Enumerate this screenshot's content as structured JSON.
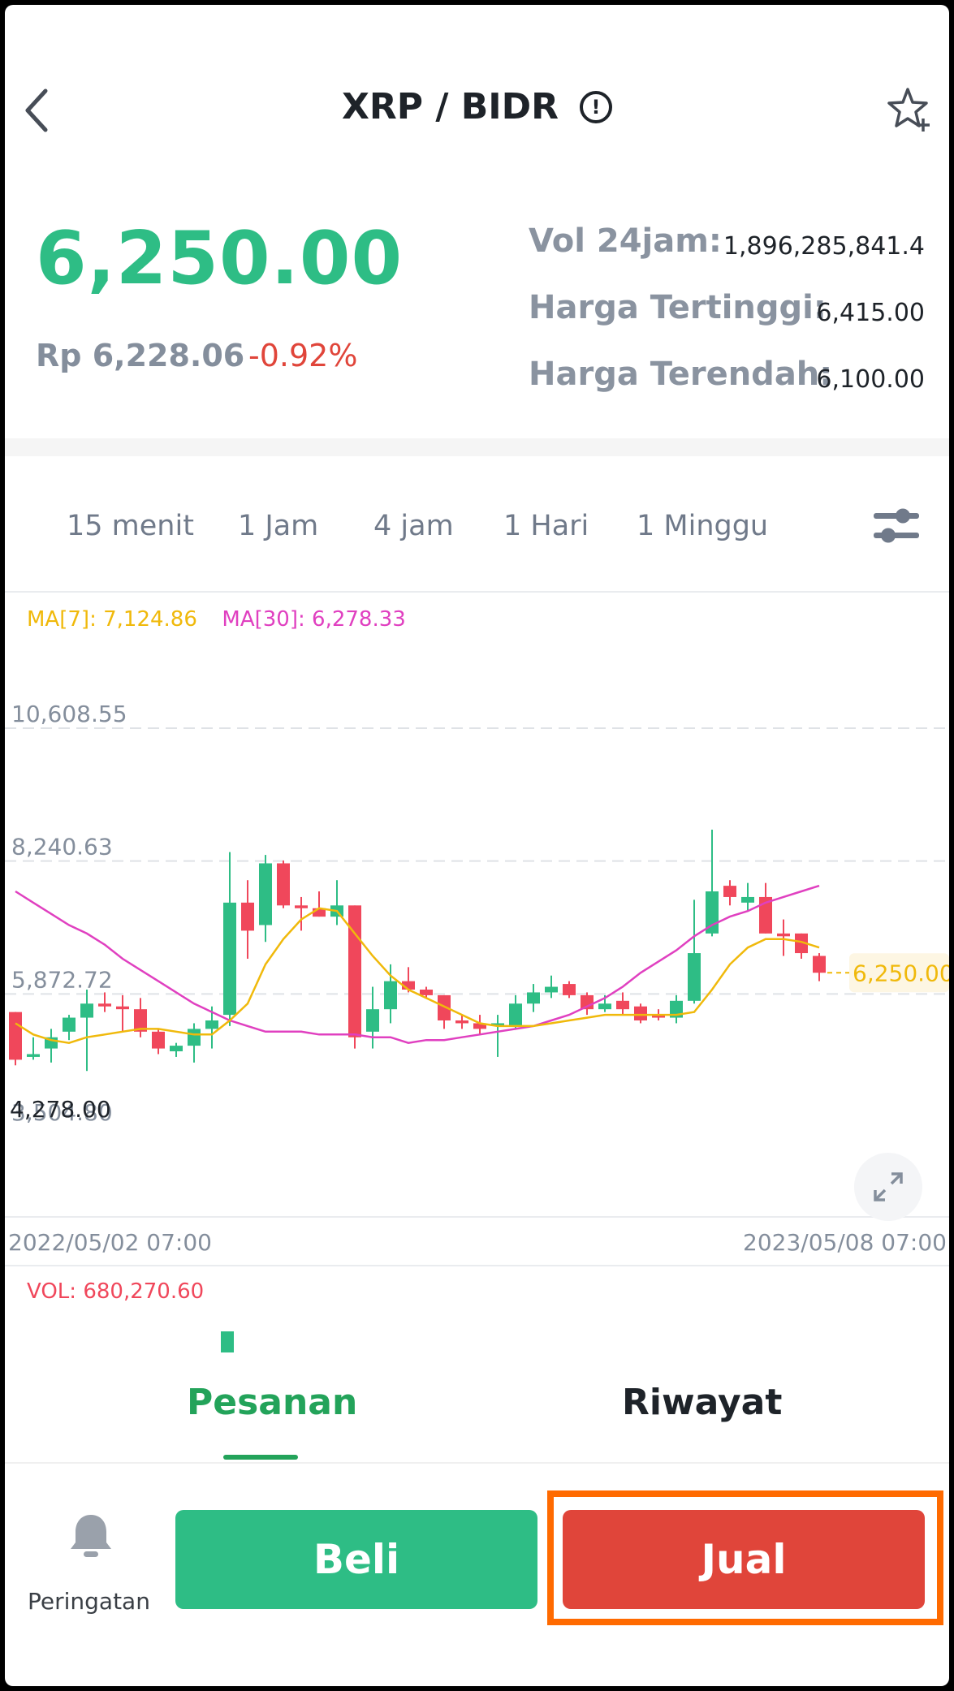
{
  "header": {
    "pair_title": "XRP / BIDR",
    "info_icon": "exclamation-circle-icon",
    "back_icon": "chevron-left-icon",
    "favorite_icon": "star-plus-icon"
  },
  "ticker": {
    "last_price": "6,250.00",
    "fiat_price": "Rp 6,228.06",
    "change_percent": "-0.92%",
    "stats": [
      {
        "label": "Vol 24jam:",
        "value": "1,896,285,841.4"
      },
      {
        "label": "Harga Tertinggi:",
        "value": "6,415.00"
      },
      {
        "label": "Harga Terendah:",
        "value": "6,100.00"
      }
    ]
  },
  "timeframes": [
    "15 menit",
    "1 Jam",
    "4 jam",
    "1 Hari",
    "1 Minggu"
  ],
  "chart_settings_icon": "sliders-icon",
  "expand_icon": "expand-diagonal-icon",
  "colors": {
    "up": "#2ebd85",
    "down": "#f0475b",
    "ma7": "#f0b90b",
    "ma30": "#e040c0",
    "sell": "#e0453a",
    "highlight": "#ff6a00"
  },
  "chart_data": {
    "type": "candlestick",
    "indicators": [
      {
        "name": "MA[7]",
        "value": "7,124.86"
      },
      {
        "name": "MA[30]",
        "value": "6,278.33"
      }
    ],
    "y_tick_labels": [
      "10,608.55",
      "8,240.63",
      "5,872.72",
      "3,504.80"
    ],
    "y_ticks": [
      10608.55,
      8240.63,
      5872.72,
      3504.8
    ],
    "ylim": [
      3504.8,
      10608.55
    ],
    "min_label": "4,278.00",
    "last_price_label": "6,250.00",
    "last_price": 6250.0,
    "x_start_label": "2022/05/02 07:00",
    "x_end_label": "2023/05/08 07:00",
    "candles": [
      {
        "o": 5550,
        "h": 5550,
        "l": 4600,
        "c": 4700
      },
      {
        "o": 4750,
        "h": 5100,
        "l": 4700,
        "c": 4800
      },
      {
        "o": 4900,
        "h": 5250,
        "l": 4650,
        "c": 5100
      },
      {
        "o": 5200,
        "h": 5500,
        "l": 5050,
        "c": 5450
      },
      {
        "o": 5450,
        "h": 5950,
        "l": 4500,
        "c": 5700
      },
      {
        "o": 5700,
        "h": 5900,
        "l": 5550,
        "c": 5650
      },
      {
        "o": 5650,
        "h": 5850,
        "l": 5200,
        "c": 5600
      },
      {
        "o": 5600,
        "h": 5800,
        "l": 5100,
        "c": 5200
      },
      {
        "o": 5200,
        "h": 5250,
        "l": 4800,
        "c": 4900
      },
      {
        "o": 4850,
        "h": 5000,
        "l": 4750,
        "c": 4950
      },
      {
        "o": 4950,
        "h": 5350,
        "l": 4650,
        "c": 5250
      },
      {
        "o": 5250,
        "h": 5650,
        "l": 4900,
        "c": 5400
      },
      {
        "o": 5500,
        "h": 8400,
        "l": 5300,
        "c": 7500
      },
      {
        "o": 7500,
        "h": 7900,
        "l": 6500,
        "c": 7000
      },
      {
        "o": 7100,
        "h": 8350,
        "l": 6800,
        "c": 8200
      },
      {
        "o": 8200,
        "h": 8250,
        "l": 7400,
        "c": 7450
      },
      {
        "o": 7450,
        "h": 7600,
        "l": 7000,
        "c": 7400
      },
      {
        "o": 7400,
        "h": 7700,
        "l": 7250,
        "c": 7250
      },
      {
        "o": 7250,
        "h": 7900,
        "l": 7100,
        "c": 7450
      },
      {
        "o": 7450,
        "h": 7450,
        "l": 4900,
        "c": 5100
      },
      {
        "o": 5200,
        "h": 6000,
        "l": 4900,
        "c": 5600
      },
      {
        "o": 5600,
        "h": 6400,
        "l": 5350,
        "c": 6100
      },
      {
        "o": 6100,
        "h": 6350,
        "l": 5900,
        "c": 5950
      },
      {
        "o": 5950,
        "h": 6000,
        "l": 5800,
        "c": 5850
      },
      {
        "o": 5850,
        "h": 5850,
        "l": 5250,
        "c": 5400
      },
      {
        "o": 5400,
        "h": 5500,
        "l": 5250,
        "c": 5350
      },
      {
        "o": 5350,
        "h": 5500,
        "l": 5150,
        "c": 5250
      },
      {
        "o": 5300,
        "h": 5500,
        "l": 4750,
        "c": 5350
      },
      {
        "o": 5300,
        "h": 5850,
        "l": 5250,
        "c": 5700
      },
      {
        "o": 5700,
        "h": 6050,
        "l": 5550,
        "c": 5900
      },
      {
        "o": 5900,
        "h": 6200,
        "l": 5800,
        "c": 6000
      },
      {
        "o": 6050,
        "h": 6100,
        "l": 5800,
        "c": 5850
      },
      {
        "o": 5850,
        "h": 5900,
        "l": 5500,
        "c": 5600
      },
      {
        "o": 5600,
        "h": 5850,
        "l": 5550,
        "c": 5700
      },
      {
        "o": 5750,
        "h": 5900,
        "l": 5500,
        "c": 5600
      },
      {
        "o": 5650,
        "h": 5700,
        "l": 5350,
        "c": 5400
      },
      {
        "o": 5500,
        "h": 5600,
        "l": 5400,
        "c": 5450
      },
      {
        "o": 5450,
        "h": 5850,
        "l": 5350,
        "c": 5750
      },
      {
        "o": 5750,
        "h": 7550,
        "l": 5700,
        "c": 6600
      },
      {
        "o": 6950,
        "h": 8800,
        "l": 6900,
        "c": 7700
      },
      {
        "o": 7800,
        "h": 7900,
        "l": 7450,
        "c": 7600
      },
      {
        "o": 7500,
        "h": 7850,
        "l": 7350,
        "c": 7600
      },
      {
        "o": 7600,
        "h": 7850,
        "l": 6950,
        "c": 6950
      },
      {
        "o": 6950,
        "h": 7200,
        "l": 6550,
        "c": 6900
      },
      {
        "o": 6950,
        "h": 6950,
        "l": 6500,
        "c": 6600
      },
      {
        "o": 6550,
        "h": 6600,
        "l": 6100,
        "c": 6250
      }
    ],
    "ma7_line": [
      5350,
      5150,
      5050,
      5000,
      5100,
      5150,
      5200,
      5250,
      5250,
      5200,
      5150,
      5150,
      5400,
      5700,
      6400,
      6850,
      7200,
      7400,
      7350,
      6950,
      6550,
      6200,
      5950,
      5800,
      5650,
      5500,
      5350,
      5300,
      5300,
      5300,
      5350,
      5400,
      5450,
      5500,
      5500,
      5500,
      5500,
      5500,
      5550,
      5950,
      6400,
      6700,
      6850,
      6850,
      6800,
      6700
    ],
    "ma30_line": [
      7700,
      7500,
      7300,
      7100,
      6950,
      6750,
      6500,
      6300,
      6100,
      5900,
      5700,
      5550,
      5400,
      5300,
      5200,
      5200,
      5200,
      5150,
      5150,
      5150,
      5100,
      5100,
      5000,
      5050,
      5050,
      5100,
      5150,
      5200,
      5250,
      5300,
      5400,
      5500,
      5650,
      5800,
      6000,
      6250,
      6450,
      6650,
      6900,
      7100,
      7250,
      7350,
      7500,
      7600,
      7700,
      7800
    ],
    "volume_indicator": {
      "name": "VOL",
      "value": "680,270.60"
    }
  },
  "tabs": [
    {
      "label": "Pesanan",
      "active": true
    },
    {
      "label": "Riwayat",
      "active": false
    }
  ],
  "bottom_bar": {
    "alert_label": "Peringatan",
    "alert_icon": "bell-icon",
    "buy_label": "Beli",
    "sell_label": "Jual"
  }
}
